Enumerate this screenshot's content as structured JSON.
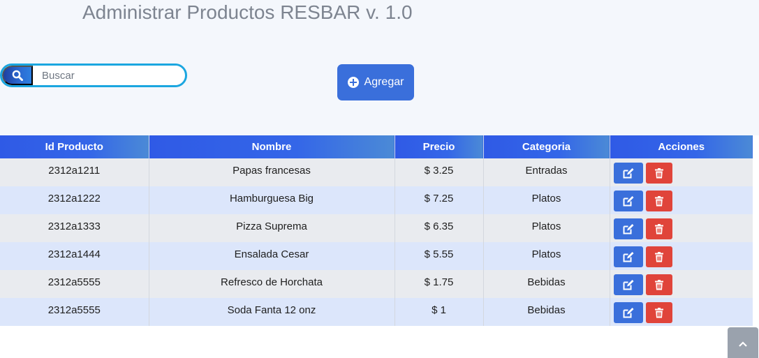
{
  "page": {
    "title": "Administrar Productos RESBAR v. 1.0"
  },
  "search": {
    "placeholder": "Buscar",
    "value": "",
    "icon": "search-icon"
  },
  "toolbar": {
    "add_label": "Agregar",
    "add_icon": "plus-circle-icon"
  },
  "table": {
    "columns": [
      "Id Producto",
      "Nombre",
      "Precio",
      "Categoria",
      "Acciones"
    ],
    "rows": [
      {
        "id": "2312a1211",
        "nombre": "Papas francesas",
        "precio": "$ 3.25",
        "categoria": "Entradas"
      },
      {
        "id": "2312a1222",
        "nombre": "Hamburguesa Big",
        "precio": "$ 7.25",
        "categoria": "Platos"
      },
      {
        "id": "2312a1333",
        "nombre": "Pizza Suprema",
        "precio": "$ 6.35",
        "categoria": "Platos"
      },
      {
        "id": "2312a1444",
        "nombre": "Ensalada Cesar",
        "precio": "$ 5.55",
        "categoria": "Platos"
      },
      {
        "id": "2312a5555",
        "nombre": "Refresco de Horchata",
        "precio": "$ 1.75",
        "categoria": "Bebidas"
      },
      {
        "id": "2312a5555",
        "nombre": "Soda Fanta 12 onz",
        "precio": "$ 1",
        "categoria": "Bebidas"
      }
    ],
    "row_actions": {
      "edit_icon": "edit-icon",
      "delete_icon": "trash-icon"
    }
  },
  "colors": {
    "accent": "#3a6fdb",
    "header_gradient_start": "#2f5ae6",
    "delete": "#e0443a",
    "row_odd": "#e9ebef",
    "row_even": "#dce6fb",
    "search_border": "#1ba6e0"
  },
  "scroll_top": {
    "icon": "chevron-up-icon"
  }
}
